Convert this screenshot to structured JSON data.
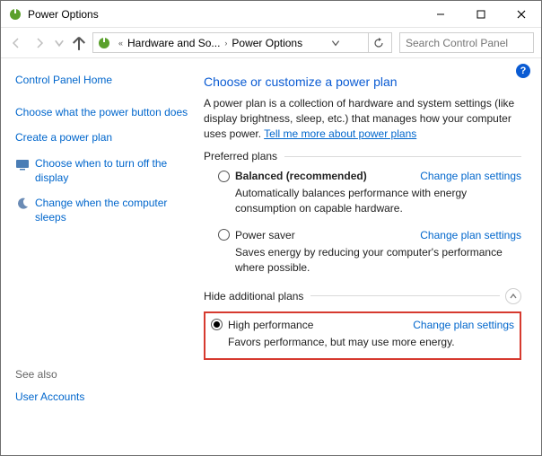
{
  "window": {
    "title": "Power Options"
  },
  "breadcrumb": {
    "seg1": "Hardware and So...",
    "seg2": "Power Options"
  },
  "search": {
    "placeholder": "Search Control Panel"
  },
  "sidebar": {
    "home": "Control Panel Home",
    "items": [
      "Choose what the power button does",
      "Create a power plan",
      "Choose when to turn off the display",
      "Change when the computer sleeps"
    ],
    "see_also": "See also",
    "user_accounts": "User Accounts"
  },
  "main": {
    "heading": "Choose or customize a power plan",
    "desc_pre": "A power plan is a collection of hardware and system settings (like display brightness, sleep, etc.) that manages how your computer uses power. ",
    "desc_link": "Tell me more about power plans",
    "preferred_label": "Preferred plans",
    "hide_label": "Hide additional plans",
    "change_link": "Change plan settings",
    "plans": {
      "balanced": {
        "name": "Balanced (recommended)",
        "desc": "Automatically balances performance with energy consumption on capable hardware."
      },
      "saver": {
        "name": "Power saver",
        "desc": "Saves energy by reducing your computer's performance where possible."
      },
      "high": {
        "name": "High performance",
        "desc": "Favors performance, but may use more energy."
      }
    }
  }
}
